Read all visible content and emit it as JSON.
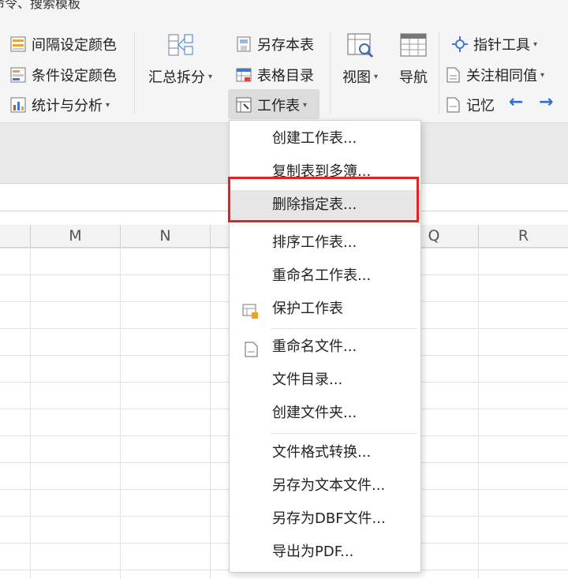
{
  "ribbon": {
    "top_text": "命令、搜索模板",
    "group1": [
      {
        "label": "间隔设定颜色",
        "icon": "interval-color-icon"
      },
      {
        "label": "条件设定颜色",
        "icon": "condition-color-icon"
      },
      {
        "label": "统计与分析",
        "icon": "statistics-icon"
      }
    ],
    "summary_split": "汇总拆分",
    "col3": [
      {
        "label": "另存本表",
        "icon": "save-sheet-icon"
      },
      {
        "label": "表格目录",
        "icon": "table-catalog-icon"
      },
      {
        "label": "工作表",
        "icon": "worksheet-icon"
      }
    ],
    "view": "视图",
    "navigate": "导航",
    "col5": [
      {
        "label": "指针工具",
        "icon": "pointer-tool-icon"
      },
      {
        "label": "关注相同值",
        "icon": "same-value-icon"
      },
      {
        "label": "记忆",
        "icon": "memory-icon"
      }
    ],
    "arrow_left": "←",
    "arrow_right": "→",
    "caret": "▾"
  },
  "columns": [
    "M",
    "N",
    "Q",
    "R"
  ],
  "menu": {
    "items": [
      {
        "label": "创建工作表...",
        "icon": null
      },
      {
        "label": "复制表到多簿...",
        "icon": null
      },
      {
        "label": "删除指定表...",
        "icon": null,
        "highlighted": true
      },
      {
        "label": "排序工作表...",
        "icon": null
      },
      {
        "label": "重命名工作表...",
        "icon": null
      },
      {
        "label": "保护工作表",
        "icon": "protect-sheet-icon"
      },
      {
        "label": "重命名文件...",
        "icon": "rename-file-icon"
      },
      {
        "label": "文件目录...",
        "icon": null
      },
      {
        "label": "创建文件夹...",
        "icon": null
      },
      {
        "label": "文件格式转换...",
        "icon": null
      },
      {
        "label": "另存为文本文件...",
        "icon": null
      },
      {
        "label": "另存为DBF文件...",
        "icon": null
      },
      {
        "label": "导出为PDF...",
        "icon": null
      }
    ]
  },
  "colors": {
    "highlight_box": "#e02424",
    "accent_arrow": "#2b6fd6"
  }
}
